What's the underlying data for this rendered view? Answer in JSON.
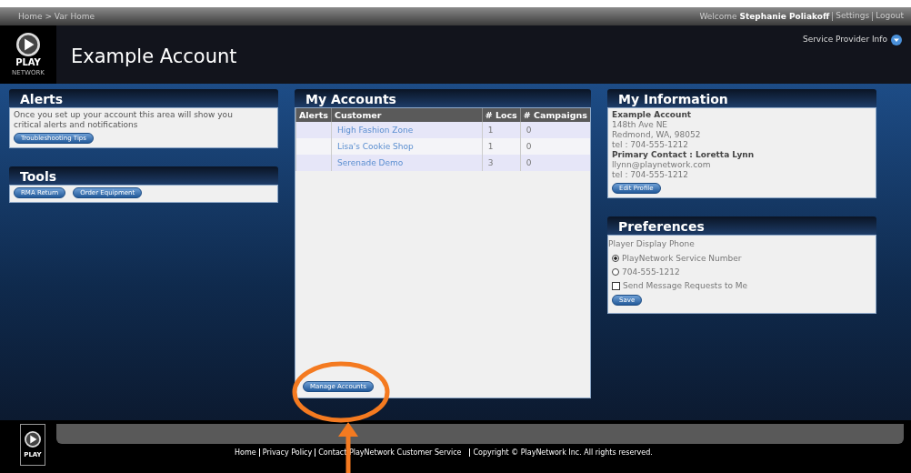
{
  "top_bar": {
    "breadcrumb": "Home > Var Home",
    "welcome": "Welcome",
    "user": "Stephanie Poliakoff",
    "links": [
      "Settings",
      "Logout"
    ]
  },
  "header": {
    "logo_text": "PLAY",
    "logo_sub": "NETWORK",
    "title": "Example Account",
    "service_link": "Service Provider Info"
  },
  "alerts": {
    "title": "Alerts",
    "message": "Once you set up your account this area will show you critical alerts and notifications",
    "button": "Troubleshooting Tips"
  },
  "tools": {
    "title": "Tools",
    "buttons": [
      "RMA Return",
      "Order Equipment"
    ]
  },
  "accounts": {
    "title": "My Accounts",
    "columns": [
      "Alerts",
      "Customer",
      "# Locs",
      "# Campaigns"
    ],
    "rows": [
      {
        "customer": "High Fashion Zone",
        "locs": "1",
        "campaigns": "0"
      },
      {
        "customer": "Lisa's Cookie Shop",
        "locs": "1",
        "campaigns": "0"
      },
      {
        "customer": "Serenade Demo",
        "locs": "3",
        "campaigns": "0"
      }
    ],
    "button": "Manage Accounts",
    "highlighted": true
  },
  "info": {
    "title": "My Information",
    "lines": [
      {
        "text": "Example Account",
        "kind": "bold"
      },
      {
        "text": "148th Ave NE",
        "kind": "plain"
      },
      {
        "text": "Redmond, WA, 98052",
        "kind": "plain"
      },
      {
        "text": "tel : 704-555-1212",
        "kind": "plain"
      },
      {
        "text": "Primary Contact : Loretta Lynn",
        "kind": "bold"
      },
      {
        "text": "llynn@playnetwork.com",
        "kind": "plain"
      },
      {
        "text": "tel : 704-555-1212",
        "kind": "plain"
      }
    ],
    "button": "Edit Profile"
  },
  "preferences": {
    "title": "Preferences",
    "label": "Player Display Phone",
    "options": [
      {
        "label": "PlayNetwork Service Number",
        "selected": true
      },
      {
        "label": "704-555-1212",
        "selected": false
      }
    ],
    "checkbox": {
      "label": "Send Message Requests to Me",
      "checked": false
    },
    "button": "Save"
  },
  "footer": {
    "logo_text": "PLAY",
    "links": [
      "Home",
      "Privacy Policy",
      "Contact PlayNetwork Customer Service"
    ],
    "copyright": "Copyright © PlayNetwork Inc. All rights reserved."
  }
}
